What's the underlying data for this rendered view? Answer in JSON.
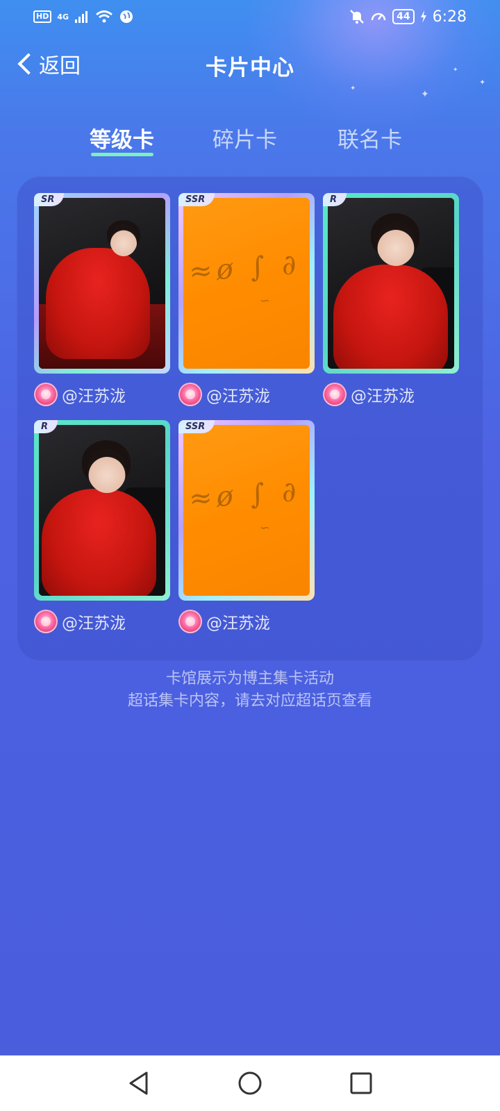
{
  "status_bar": {
    "hd": "HD",
    "network": "4G",
    "battery": "44",
    "time": "6:28"
  },
  "nav": {
    "back_label": "返回",
    "title": "卡片中心"
  },
  "tabs": [
    {
      "label": "等级卡",
      "active": true
    },
    {
      "label": "碎片卡",
      "active": false
    },
    {
      "label": "联名卡",
      "active": false
    }
  ],
  "cards": [
    {
      "rarity": "SR",
      "author": "@汪苏泷",
      "image": "photo-sitting"
    },
    {
      "rarity": "SSR",
      "author": "@汪苏泷",
      "image": "orange-handwriting"
    },
    {
      "rarity": "R",
      "author": "@汪苏泷",
      "image": "photo-portrait"
    },
    {
      "rarity": "R",
      "author": "@汪苏泷",
      "image": "photo-portrait"
    },
    {
      "rarity": "SSR",
      "author": "@汪苏泷",
      "image": "orange-handwriting"
    }
  ],
  "footer": {
    "line1": "卡馆展示为博主集卡活动",
    "line2": "超话集卡内容，请去对应超话页查看"
  },
  "colors": {
    "background_top": "#3f8ff0",
    "background_bottom": "#4a5edc",
    "tab_indicator": "#7ef0b9",
    "ssr_card": "#ff8c00"
  }
}
